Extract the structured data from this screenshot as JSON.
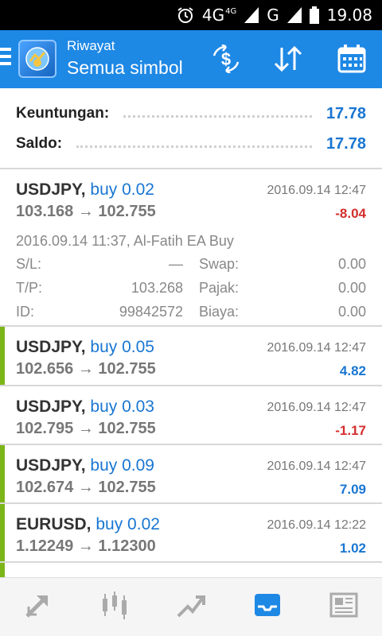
{
  "status_bar": {
    "network_4g": "4G",
    "network_4g_sup": "4G",
    "network_g": "G",
    "time": "19.08"
  },
  "app_bar": {
    "subtitle": "Riwayat",
    "title": "Semua simbol",
    "icons": [
      "menu-icon",
      "app-logo",
      "currency-exchange-icon",
      "sort-icon",
      "calendar-icon"
    ]
  },
  "summary": {
    "profit_label": "Keuntungan:",
    "profit_value": "17.78",
    "balance_label": "Saldo:",
    "balance_value": "17.78"
  },
  "deals": [
    {
      "symbol": "USDJPY,",
      "side": "buy 0.02",
      "time": "2016.09.14 12:47",
      "open_price": "103.168",
      "arrow": "→",
      "close_price": "102.755",
      "profit": "-8.04",
      "detail": {
        "open_line": "2016.09.14 11:37, Al-Fatih EA Buy",
        "sl_label": "S/L:",
        "sl_value": "—",
        "swap_label": "Swap:",
        "swap_value": "0.00",
        "tp_label": "T/P:",
        "tp_value": "103.268",
        "tax_label": "Pajak:",
        "tax_value": "0.00",
        "id_label": "ID:",
        "id_value": "99842572",
        "fee_label": "Biaya:",
        "fee_value": "0.00"
      }
    },
    {
      "symbol": "USDJPY,",
      "side": "buy 0.05",
      "time": "2016.09.14 12:47",
      "open_price": "102.656",
      "arrow": "→",
      "close_price": "102.755",
      "profit": "4.82"
    },
    {
      "symbol": "USDJPY,",
      "side": "buy 0.03",
      "time": "2016.09.14 12:47",
      "open_price": "102.795",
      "arrow": "→",
      "close_price": "102.755",
      "profit": "-1.17"
    },
    {
      "symbol": "USDJPY,",
      "side": "buy 0.09",
      "time": "2016.09.14 12:47",
      "open_price": "102.674",
      "arrow": "→",
      "close_price": "102.755",
      "profit": "7.09"
    },
    {
      "symbol": "EURUSD,",
      "side": "buy 0.02",
      "time": "2016.09.14 12:22",
      "open_price": "1.12249",
      "arrow": "→",
      "close_price": "1.12300",
      "profit": "1.02"
    }
  ],
  "colors": {
    "accent": "#1e88e5",
    "profit_positive": "#1976d2",
    "profit_negative": "#d32f2f",
    "deal_bar": "#7cb518",
    "active_tab": "#1e88e5"
  },
  "bottom_nav": [
    "trade-icon",
    "chart-candles-icon",
    "trend-icon",
    "history-inbox-icon",
    "news-icon"
  ]
}
